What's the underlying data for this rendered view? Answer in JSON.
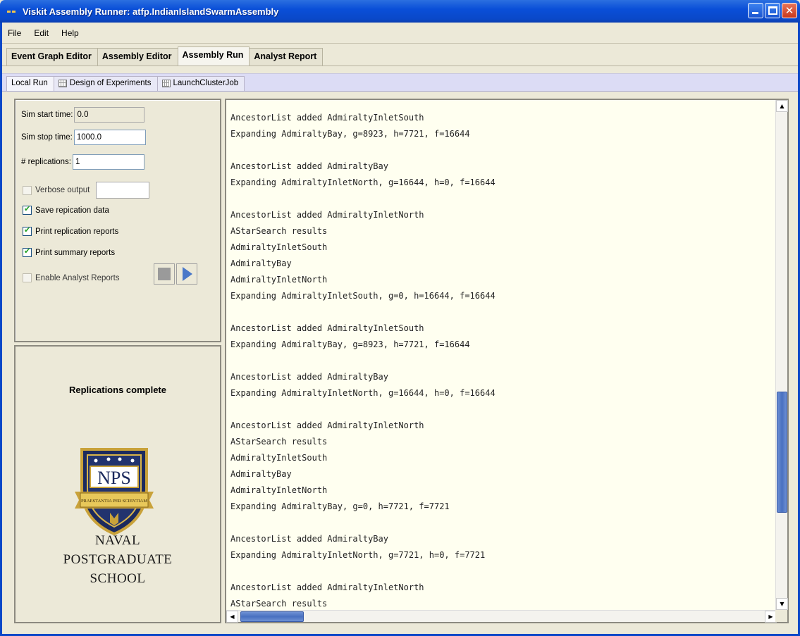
{
  "window": {
    "title": "Viskit Assembly Runner: atfp.IndianIslandSwarmAssembly"
  },
  "menu": [
    "File",
    "Edit",
    "Help"
  ],
  "main_tabs": [
    "Event Graph Editor",
    "Assembly Editor",
    "Assembly Run",
    "Analyst Report"
  ],
  "sub_tabs": [
    "Local Run",
    "Design of Experiments",
    "LaunchClusterJob"
  ],
  "params": {
    "sim_start_label": "Sim start time:",
    "sim_start_value": "0.0",
    "sim_stop_label": "Sim stop time:",
    "sim_stop_value": "1000.0",
    "replications_label": "# replications:",
    "replications_value": "1",
    "verbose_label": "Verbose output",
    "verbose_value": "",
    "save_label": "Save repication data",
    "print_rep_label": "Print replication reports",
    "print_sum_label": "Print summary reports",
    "enable_analyst_label": "Enable Analyst Reports"
  },
  "status": {
    "message": "Replications complete",
    "logo_text": "NPS",
    "logo_motto": "PRAESTANTIA PER SCIENTIAM",
    "school_line1": "NAVAL",
    "school_line2": "POSTGRADUATE",
    "school_line3": "SCHOOL"
  },
  "output_lines": [
    "AncestorList added AdmiraltyInletSouth",
    "Expanding AdmiraltyBay, g=8923, h=7721, f=16644",
    "",
    "AncestorList added AdmiraltyBay",
    "Expanding AdmiraltyInletNorth, g=16644, h=0, f=16644",
    "",
    "AncestorList added AdmiraltyInletNorth",
    "AStarSearch results",
    "AdmiraltyInletSouth",
    "AdmiraltyBay",
    "AdmiraltyInletNorth",
    "Expanding AdmiraltyInletSouth, g=0, h=16644, f=16644",
    "",
    "AncestorList added AdmiraltyInletSouth",
    "Expanding AdmiraltyBay, g=8923, h=7721, f=16644",
    "",
    "AncestorList added AdmiraltyBay",
    "Expanding AdmiraltyInletNorth, g=16644, h=0, f=16644",
    "",
    "AncestorList added AdmiraltyInletNorth",
    "AStarSearch results",
    "AdmiraltyInletSouth",
    "AdmiraltyBay",
    "AdmiraltyInletNorth",
    "Expanding AdmiraltyBay, g=0, h=7721, f=7721",
    "",
    "AncestorList added AdmiraltyBay",
    "Expanding AdmiraltyInletNorth, g=7721, h=0, f=7721",
    "",
    "AncestorList added AdmiraltyInletNorth",
    "AStarSearch results"
  ],
  "colors": {
    "title_bar": "#0a48c8",
    "output_bg": "#fffff0",
    "scroll_thumb": "#4870c0"
  }
}
